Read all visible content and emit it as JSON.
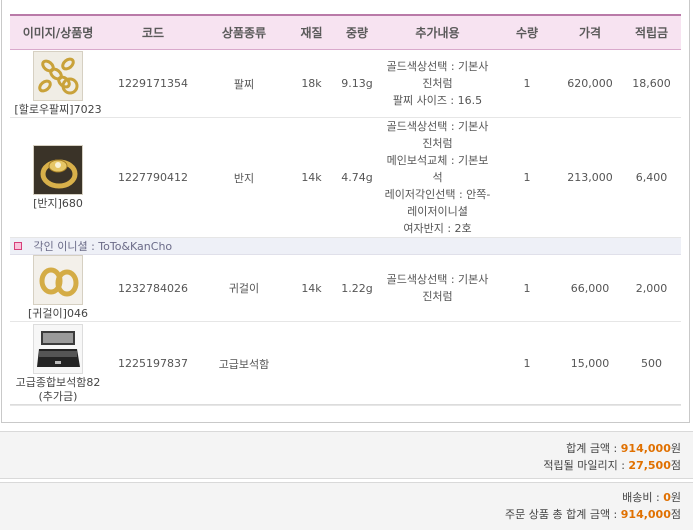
{
  "table": {
    "headers": [
      "이미지/상품명",
      "코드",
      "상품종류",
      "재질",
      "중량",
      "추가내용",
      "수량",
      "가격",
      "적립금"
    ],
    "rows": [
      {
        "name": "[할로우팔찌]7023",
        "code": "1229171354",
        "type": "팔찌",
        "material": "18k",
        "weight": "9.13g",
        "options": [
          "골드색상선택 : 기본사",
          "진처럼",
          "팔찌 사이즈 : 16.5"
        ],
        "qty": "1",
        "price": "620,000",
        "points": "18,600"
      },
      {
        "name": "[반지]680",
        "code": "1227790412",
        "type": "반지",
        "material": "14k",
        "weight": "4.74g",
        "options": [
          "골드색상선택 : 기본사",
          "진처럼",
          "메인보석교체 : 기본보",
          "석",
          "레이저각인선택 : 안쪽-",
          "레이저이니셜",
          "여자반지 : 2호"
        ],
        "qty": "1",
        "price": "213,000",
        "points": "6,400"
      },
      {
        "name": "[귀걸이]046",
        "code": "1232784026",
        "type": "귀걸이",
        "material": "14k",
        "weight": "1.22g",
        "options": [
          "골드색상선택 : 기본사",
          "진처럼"
        ],
        "qty": "1",
        "price": "66,000",
        "points": "2,000"
      },
      {
        "name_lines": [
          "고급종합보석함82",
          "(추가금)"
        ],
        "code": "1225197837",
        "type": "고급보석함",
        "material": "",
        "weight": "",
        "qty": "1",
        "price": "15,000",
        "points": "500"
      }
    ],
    "engraving_note": "각인 이니셜 : ToTo&KanCho"
  },
  "summary": {
    "total_label": "합계 금액 : ",
    "total_value": "914,000",
    "total_unit": "원",
    "mileage_label": "적립될 마일리지 : ",
    "mileage_value": "27,500",
    "mileage_unit": "점",
    "shipping_label": "배송비 : ",
    "shipping_value": "0",
    "shipping_unit": "원",
    "grand_label": "주문 상품 총 합계 금액 : ",
    "grand_value": "914,000",
    "grand_unit": "점"
  },
  "icons": {
    "note_icon": "bullet-square-icon"
  },
  "colors": {
    "header_bg": "#f7e3f1",
    "header_border": "#b97aa8",
    "amount_orange": "#e07000",
    "note_row_bg": "#eef0f7"
  }
}
